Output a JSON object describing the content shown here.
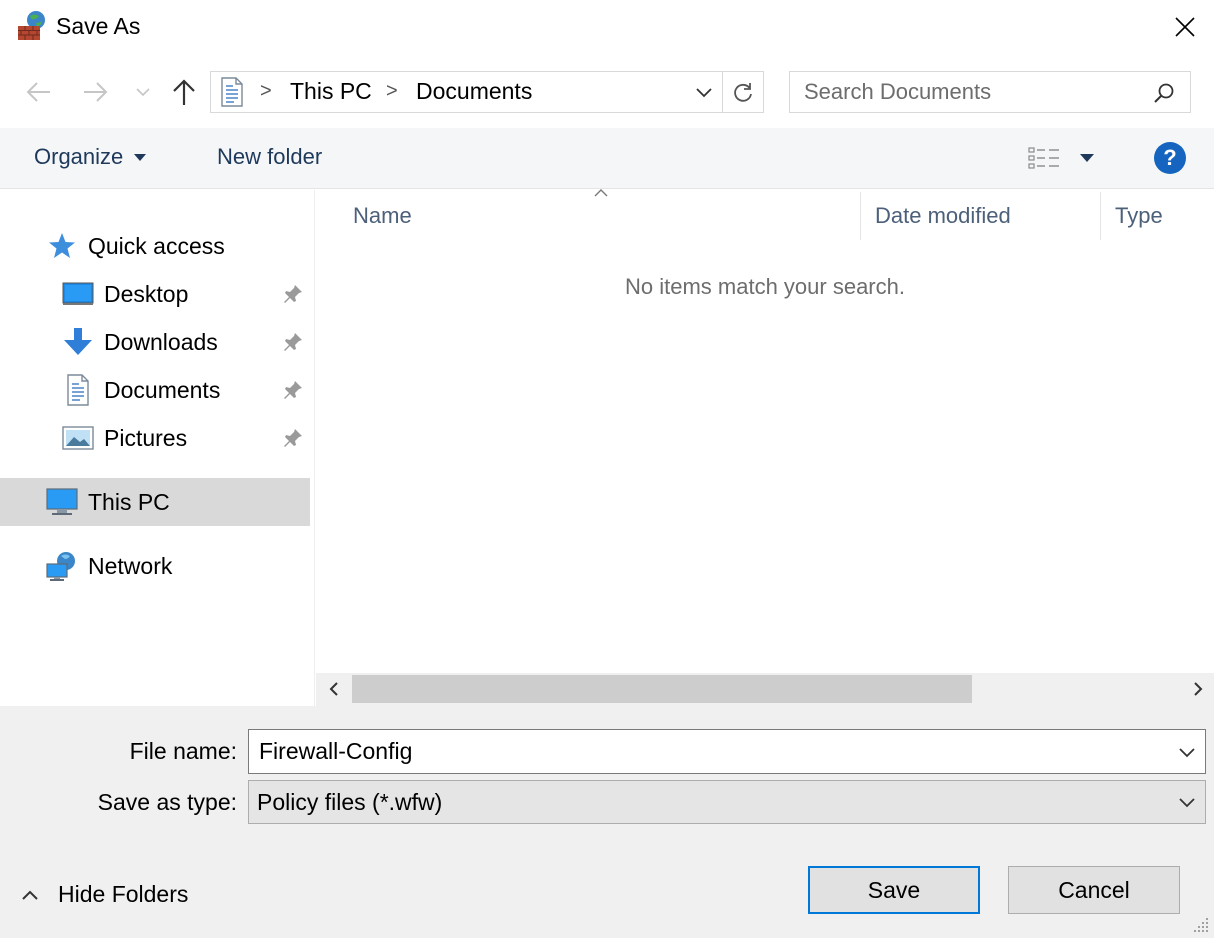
{
  "window": {
    "title": "Save As"
  },
  "address": {
    "breadcrumbs": [
      "This PC",
      "Documents"
    ],
    "separator": ">"
  },
  "search": {
    "placeholder": "Search Documents"
  },
  "commandbar": {
    "organize_label": "Organize",
    "new_folder_label": "New folder"
  },
  "nav": {
    "quick_access": "Quick access",
    "items": [
      {
        "label": "Desktop",
        "icon": "desktop-icon",
        "pinned": true
      },
      {
        "label": "Downloads",
        "icon": "downloads-icon",
        "pinned": true
      },
      {
        "label": "Documents",
        "icon": "documents-icon",
        "pinned": true
      },
      {
        "label": "Pictures",
        "icon": "pictures-icon",
        "pinned": true
      }
    ],
    "this_pc": "This PC",
    "network": "Network"
  },
  "columns": [
    "Name",
    "Date modified",
    "Type"
  ],
  "empty_message": "No items match your search.",
  "form": {
    "file_name_label": "File name:",
    "file_name_value": "Firewall-Config",
    "save_type_label": "Save as type:",
    "save_type_value": "Policy files (*.wfw)"
  },
  "footer": {
    "hide_folders_label": "Hide Folders",
    "save_label": "Save",
    "cancel_label": "Cancel"
  },
  "colors": {
    "accent": "#0078d7",
    "command_text": "#1e395b",
    "header_text": "#4c607a",
    "selected_nav": "#d9d9d9",
    "bottom_bg": "#f0f0f0"
  }
}
